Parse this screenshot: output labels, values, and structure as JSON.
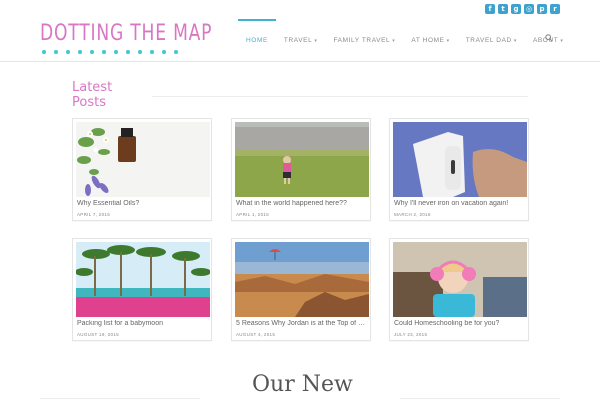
{
  "site": {
    "logo_text": "DOTTING THE MAP",
    "accent": "#d977c4",
    "nav_accent": "#3db3d8"
  },
  "social": [
    {
      "icon": "facebook-icon",
      "glyph": "f"
    },
    {
      "icon": "twitter-icon",
      "glyph": "t"
    },
    {
      "icon": "google-plus-icon",
      "glyph": "g"
    },
    {
      "icon": "instagram-icon",
      "glyph": "◎"
    },
    {
      "icon": "pinterest-icon",
      "glyph": "p"
    },
    {
      "icon": "rss-icon",
      "glyph": "r"
    }
  ],
  "nav": {
    "items": [
      {
        "label": "HOME",
        "active": true,
        "dropdown": false
      },
      {
        "label": "TRAVEL",
        "active": false,
        "dropdown": true
      },
      {
        "label": "FAMILY TRAVEL",
        "active": false,
        "dropdown": true
      },
      {
        "label": "AT HOME",
        "active": false,
        "dropdown": true
      },
      {
        "label": "TRAVEL DAD",
        "active": false,
        "dropdown": true
      },
      {
        "label": "ABOUT",
        "active": false,
        "dropdown": true
      }
    ],
    "search_icon": "search-icon"
  },
  "latest": {
    "heading": "Latest Posts",
    "posts": [
      {
        "title": "Why Essential Oils?",
        "date": "APRIL 7, 2016"
      },
      {
        "title": "What in the world happened here??",
        "date": "APRIL 1, 2016"
      },
      {
        "title": "Why I'll never iron on vacation again!",
        "date": "MARCH 2, 2016"
      },
      {
        "title": "Packing list for a babymoon",
        "date": "AUGUST 19, 2015"
      },
      {
        "title": "5 Reasons Why Jordan is at the Top of M…",
        "date": "AUGUST 4, 2015"
      },
      {
        "title": "Could Homeschooling be for you?",
        "date": "JULY 23, 2015"
      }
    ]
  },
  "next_section": {
    "heading": "Our New"
  }
}
